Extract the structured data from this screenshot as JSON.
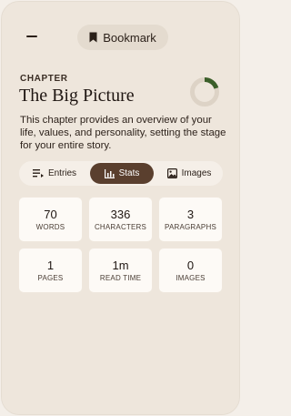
{
  "header": {
    "bookmark_label": "Bookmark"
  },
  "chapter": {
    "label": "CHAPTER",
    "title": "The Big Picture",
    "description": "This chapter provides an overview of your life, values, and personality, setting the stage for your entire story.",
    "progress": 0.2
  },
  "tabs": [
    {
      "label": "Entries",
      "icon": "list-icon",
      "selected": false
    },
    {
      "label": "Stats",
      "icon": "bar-chart-icon",
      "selected": true
    },
    {
      "label": "Images",
      "icon": "image-icon",
      "selected": false
    }
  ],
  "stats": [
    {
      "value": "70",
      "label": "WORDS"
    },
    {
      "value": "336",
      "label": "CHARACTERS"
    },
    {
      "value": "3",
      "label": "PARAGRAPHS"
    },
    {
      "value": "1",
      "label": "PAGES"
    },
    {
      "value": "1m",
      "label": "READ TIME"
    },
    {
      "value": "0",
      "label": "IMAGES"
    }
  ],
  "colors": {
    "background": "#eee6dc",
    "accent": "#5a3f2e",
    "progress": "#3b5f2a",
    "card": "#fdfaf6"
  }
}
